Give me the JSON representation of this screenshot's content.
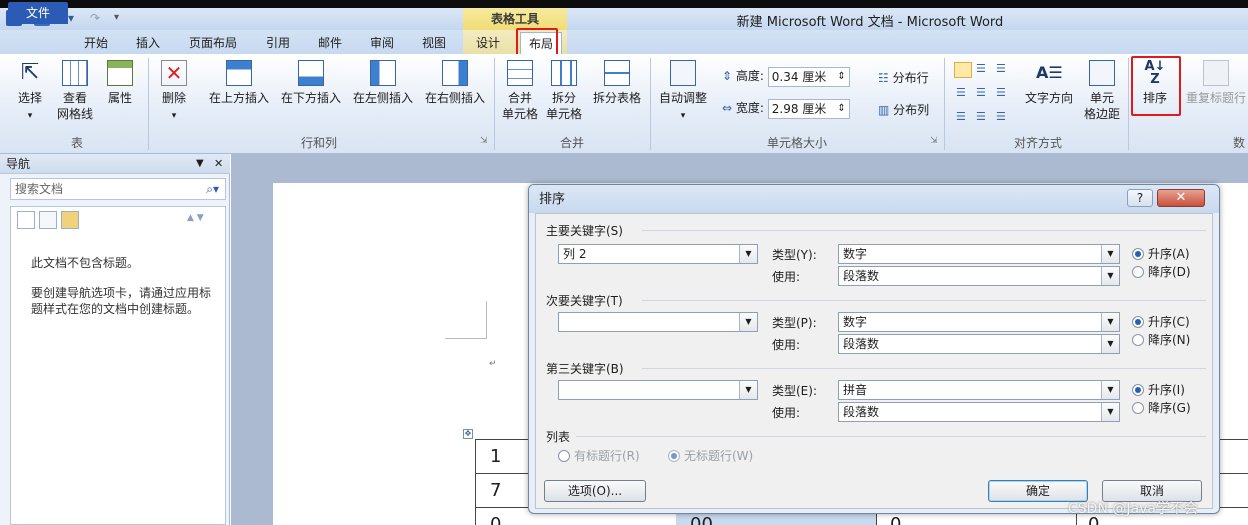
{
  "window": {
    "title": "新建 Microsoft Word 文档 - Microsoft Word",
    "context_group": "表格工具"
  },
  "tabs": {
    "file": "文件",
    "home": "开始",
    "insert": "插入",
    "page_layout": "页面布局",
    "references": "引用",
    "mailings": "邮件",
    "review": "审阅",
    "view": "视图",
    "design": "设计",
    "layout": "布局"
  },
  "ribbon": {
    "table": {
      "select": "选择",
      "gridlines_1": "查看",
      "gridlines_2": "网格线",
      "properties": "属性",
      "group": "表"
    },
    "rows_cols": {
      "delete": "删除",
      "insert_above": "在上方插入",
      "insert_below": "在下方插入",
      "insert_left": "在左侧插入",
      "insert_right": "在右侧插入",
      "group": "行和列"
    },
    "merge": {
      "merge_1": "合并",
      "merge_2": "单元格",
      "split_1": "拆分",
      "split_2": "单元格",
      "split_table": "拆分表格",
      "group": "合并"
    },
    "cell_size": {
      "autofit": "自动调整",
      "height_label": "高度:",
      "height_value": "0.34 厘米",
      "width_label": "宽度:",
      "width_value": "2.98 厘米",
      "distribute_rows": "分布行",
      "distribute_cols": "分布列",
      "group": "单元格大小"
    },
    "alignment": {
      "text_direction": "文字方向",
      "margins_1": "单元",
      "margins_2": "格边距",
      "group": "对齐方式"
    },
    "data": {
      "sort": "排序",
      "repeat_header": "重复标题行",
      "group": "数"
    }
  },
  "nav": {
    "title": "导航",
    "search_placeholder": "搜索文档",
    "msg1": "此文档不包含标题。",
    "msg2": "要创建导航选项卡，请通过应用标题样式在您的文档中创建标题。"
  },
  "doc": {
    "cells": [
      "1",
      "7",
      "0",
      "00",
      "0",
      "0"
    ]
  },
  "dialog": {
    "title": "排序",
    "primary": {
      "label": "主要关键字(S)",
      "key": "列 2",
      "type_label": "类型(Y):",
      "type": "数字",
      "use_label": "使用:",
      "use": "段落数",
      "asc": "升序(A)",
      "desc": "降序(D)"
    },
    "secondary": {
      "label": "次要关键字(T)",
      "key": "",
      "type_label": "类型(P):",
      "type": "数字",
      "use_label": "使用:",
      "use": "段落数",
      "asc": "升序(C)",
      "desc": "降序(N)"
    },
    "tertiary": {
      "label": "第三关键字(B)",
      "key": "",
      "type_label": "类型(E):",
      "type": "拼音",
      "use_label": "使用:",
      "use": "段落数",
      "asc": "升序(I)",
      "desc": "降序(G)"
    },
    "list": {
      "label": "列表",
      "has_header": "有标题行(R)",
      "no_header": "无标题行(W)"
    },
    "buttons": {
      "options": "选项(O)...",
      "ok": "确定",
      "cancel": "取消"
    }
  },
  "watermark": "CSDN @Java学不会",
  "colors": {
    "accent": "#2b5bb5",
    "highlight": "#e1191b",
    "context": "#f0dd74"
  }
}
